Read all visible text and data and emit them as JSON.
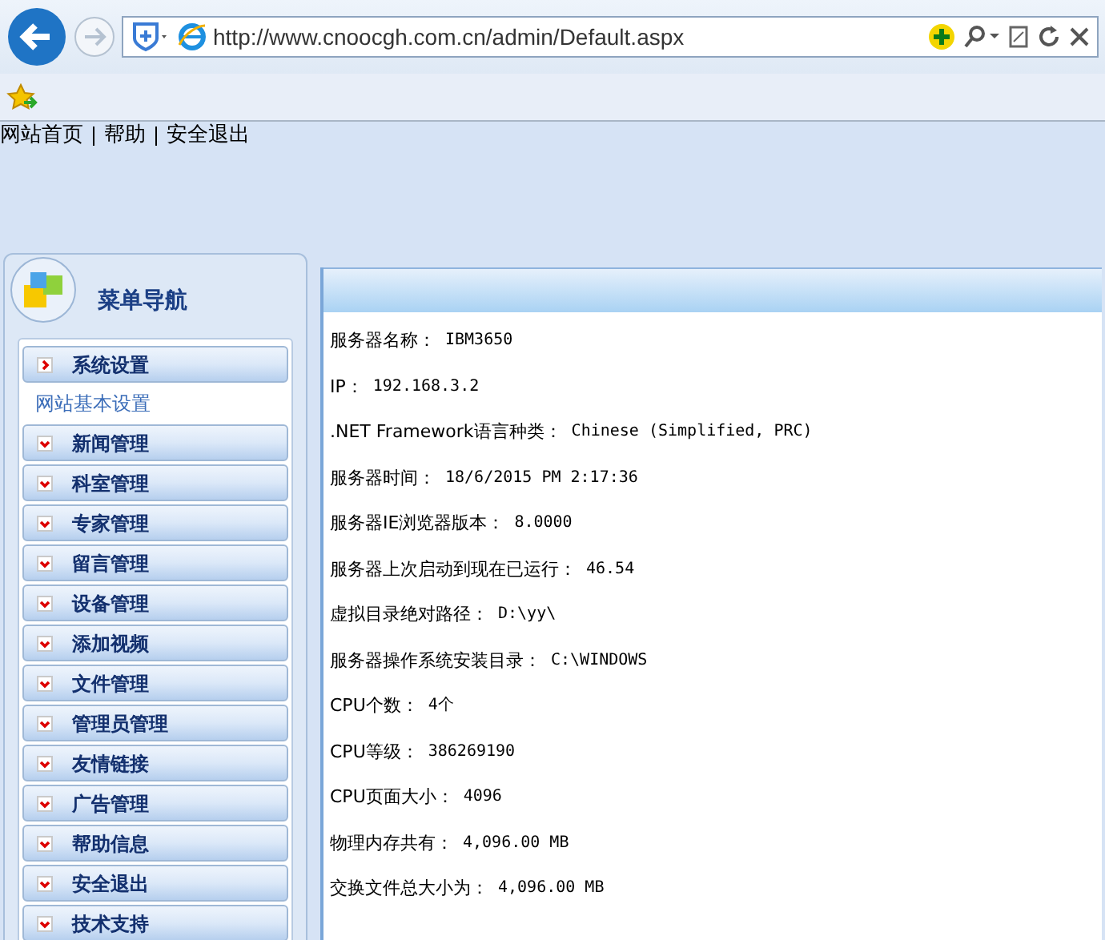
{
  "browser": {
    "address": "http://www.cnoocgh.com.cn/admin/Default.aspx"
  },
  "top_links": [
    "网站首页",
    "帮助",
    "安全退出"
  ],
  "sidebar": {
    "title": "菜单导航",
    "items": [
      {
        "label": "系统设置",
        "expanded": true,
        "children": [
          {
            "label": "网站基本设置"
          }
        ]
      },
      {
        "label": "新闻管理",
        "expanded": false
      },
      {
        "label": "科室管理",
        "expanded": false
      },
      {
        "label": "专家管理",
        "expanded": false
      },
      {
        "label": "留言管理",
        "expanded": false
      },
      {
        "label": "设备管理",
        "expanded": false
      },
      {
        "label": "添加视频",
        "expanded": false
      },
      {
        "label": "文件管理",
        "expanded": false
      },
      {
        "label": "管理员管理",
        "expanded": false
      },
      {
        "label": "友情链接",
        "expanded": false
      },
      {
        "label": "广告管理",
        "expanded": false
      },
      {
        "label": "帮助信息",
        "expanded": false
      },
      {
        "label": "安全退出",
        "expanded": false
      },
      {
        "label": "技术支持",
        "expanded": false
      }
    ]
  },
  "server_info": [
    {
      "label": "服务器名称：",
      "value": "IBM3650"
    },
    {
      "label": "IP：",
      "value": "192.168.3.2"
    },
    {
      "label": ".NET Framework语言种类：",
      "value": "Chinese (Simplified, PRC)"
    },
    {
      "label": "服务器时间：",
      "value": "18/6/2015 PM 2:17:36"
    },
    {
      "label": "服务器IE浏览器版本：",
      "value": "8.0000"
    },
    {
      "label": "服务器上次启动到现在已运行：",
      "value": "46.54"
    },
    {
      "label": "虚拟目录绝对路径：",
      "value": "D:\\yy\\"
    },
    {
      "label": "服务器操作系统安装目录：",
      "value": "C:\\WINDOWS"
    },
    {
      "label": "CPU个数：",
      "value": "4个"
    },
    {
      "label": "CPU等级：",
      "value": "386269190"
    },
    {
      "label": "CPU页面大小：",
      "value": "4096"
    },
    {
      "label": "物理内存共有：",
      "value": "4,096.00 MB"
    },
    {
      "label": "交换文件总大小为：",
      "value": "4,096.00 MB"
    }
  ]
}
